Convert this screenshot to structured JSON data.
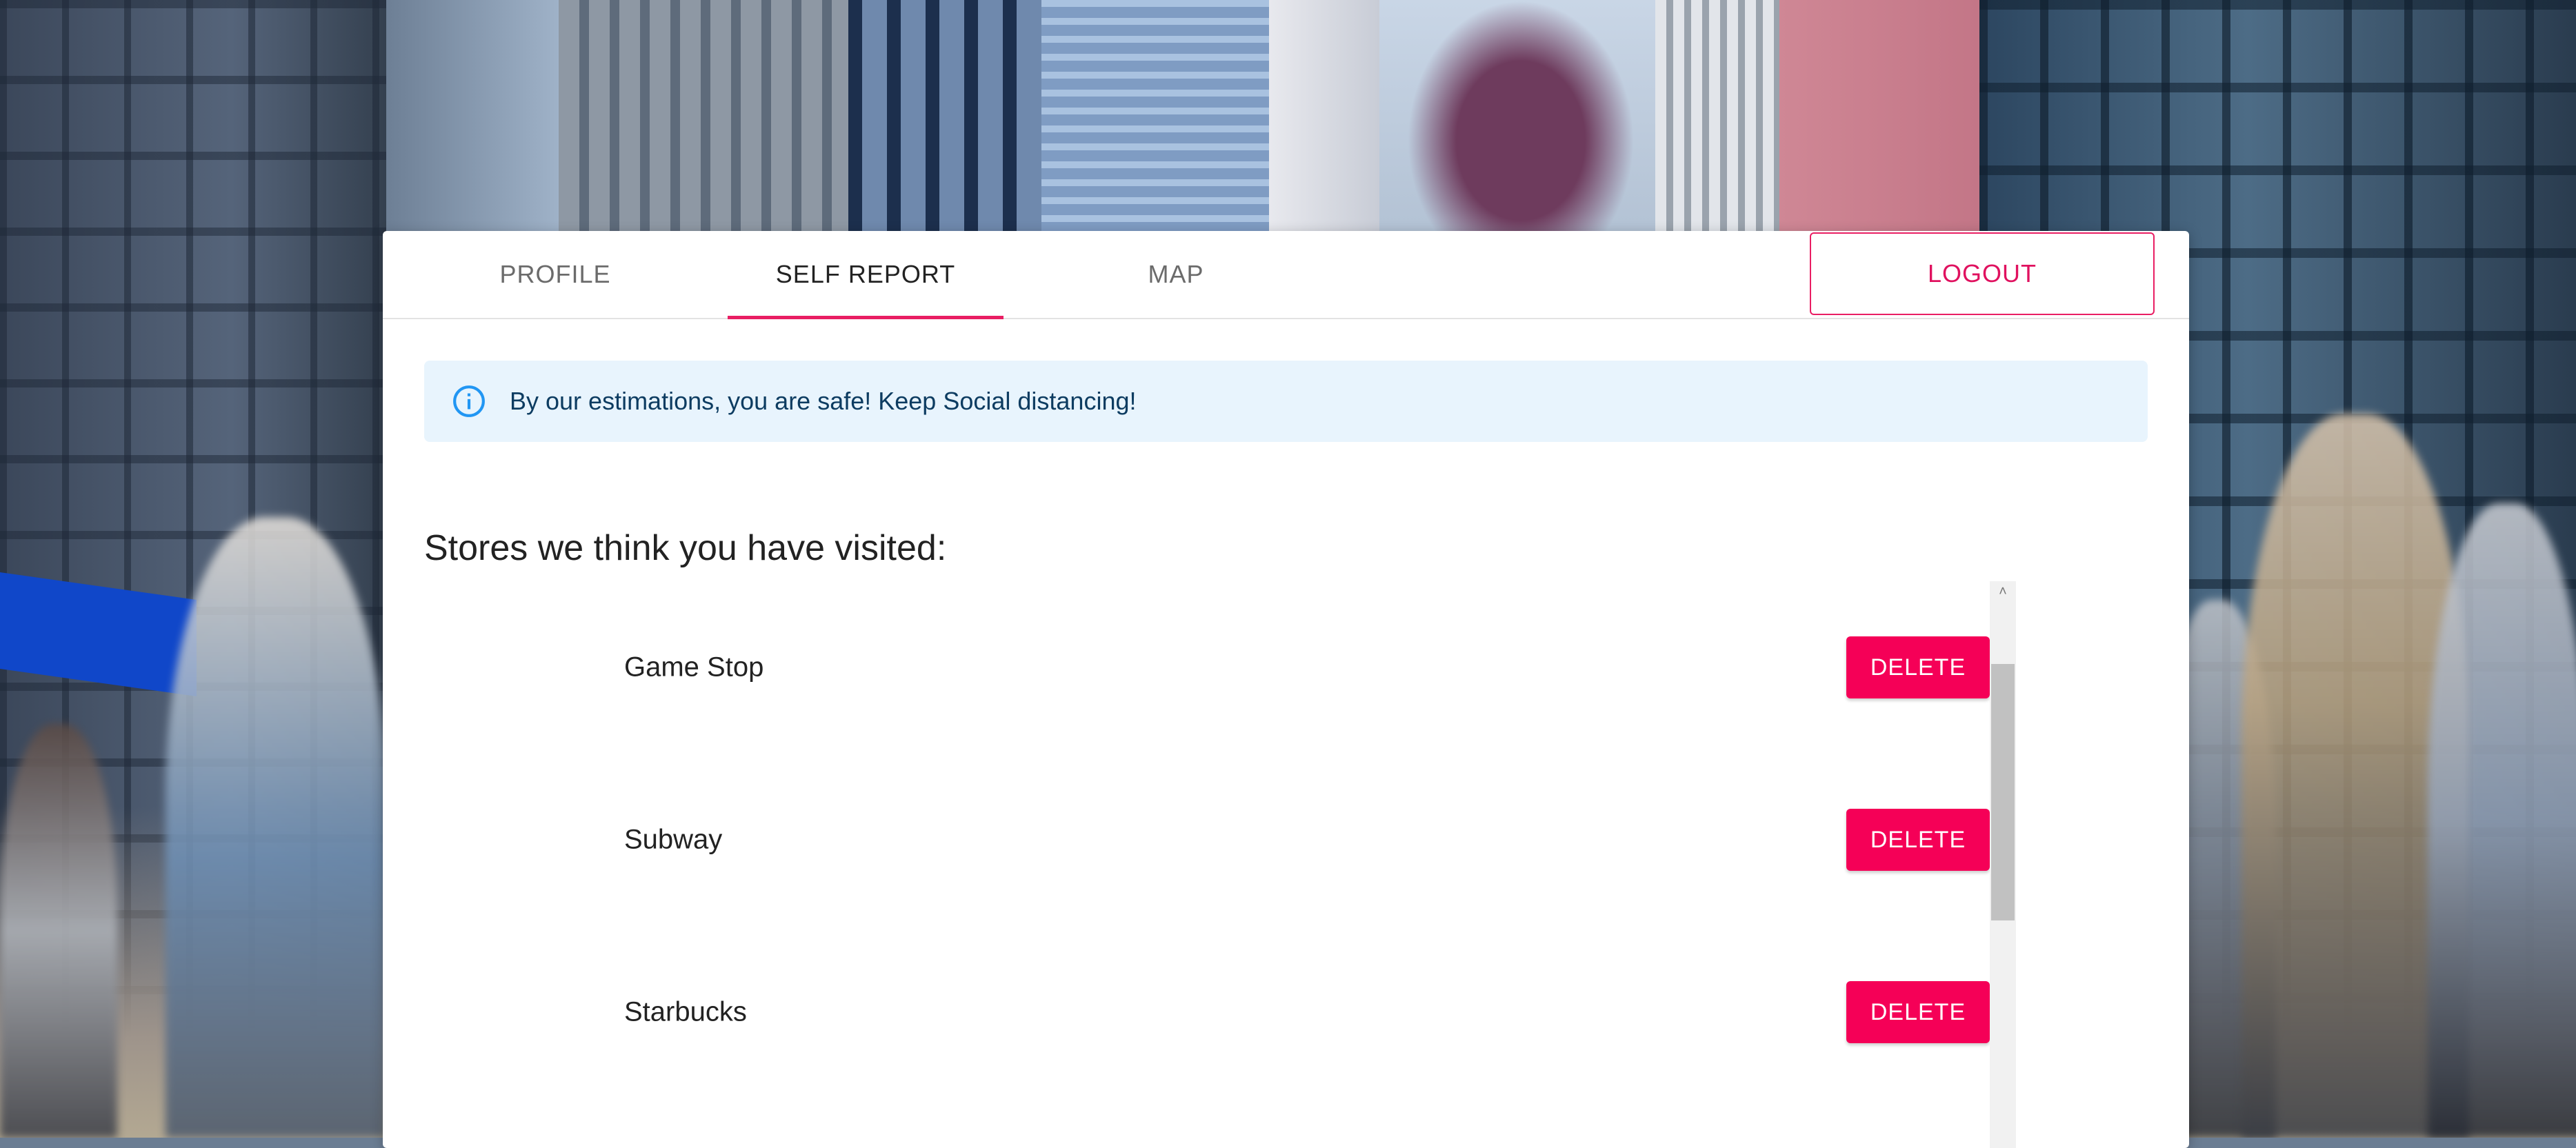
{
  "tabs": {
    "profile": "PROFILE",
    "self_report": "SELF REPORT",
    "map": "MAP",
    "active": "SELF REPORT"
  },
  "logout_label": "LOGOUT",
  "alert": {
    "icon": "info-icon",
    "message": "By our estimations, you are safe! Keep Social distancing!"
  },
  "stores": {
    "heading": "Stores we think you have visited:",
    "items": [
      {
        "name": "Game Stop",
        "action": "DELETE"
      },
      {
        "name": "Subway",
        "action": "DELETE"
      },
      {
        "name": "Starbucks",
        "action": "DELETE"
      }
    ]
  },
  "colors": {
    "accent": "#e91e63",
    "delete_button": "#f50057",
    "alert_bg": "#e8f4fd",
    "alert_text": "#0d3c61",
    "alert_icon": "#2196f3"
  }
}
